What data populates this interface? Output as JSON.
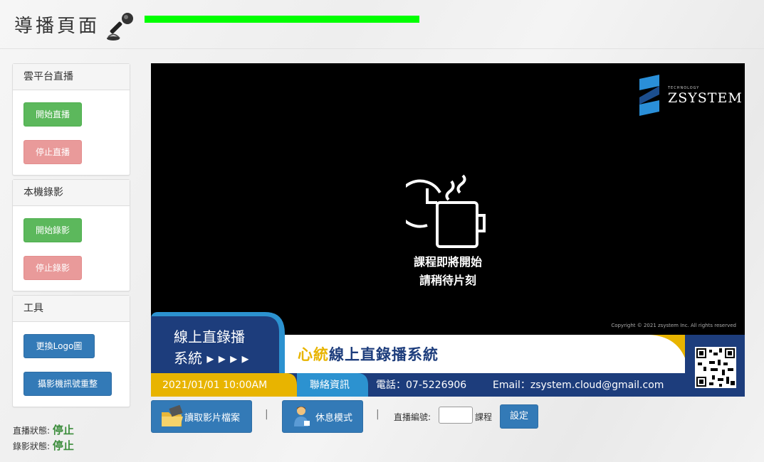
{
  "header": {
    "title": "導播頁面",
    "mic_icon": "microphone-icon",
    "audio_level": 1.0,
    "level_color": "#00ff00"
  },
  "sidebar": {
    "cloud_live": {
      "title": "雲平台直播",
      "start_label": "開始直播",
      "stop_label": "停止直播"
    },
    "local_record": {
      "title": "本機錄影",
      "start_label": "開始錄影",
      "stop_label": "停止錄影"
    },
    "tools": {
      "title": "工具",
      "logo_label": "更換Logo圖",
      "camera_label": "攝影機訊號重整"
    }
  },
  "status": {
    "live_label": "直播狀態:",
    "live_value": "停止",
    "record_label": "錄影狀態:",
    "record_value": "停止"
  },
  "preview": {
    "brand_tech": "TECHNOLOGY",
    "brand_name": "ZSYSTEM",
    "center_icon": "clock-coffee-icon",
    "message_line1": "課程即將開始",
    "message_line2": "請稍待片刻",
    "copyright": "Copyright © 2021 zsystem Inc. All rights reserved",
    "lower_third": {
      "tag_line1": "線上直錄播",
      "tag_line2": "系統 ▸ ▸ ▸ ▸",
      "title_highlight": "心統",
      "title_rest": "線上直錄播系統",
      "datetime": "2021/01/01   10:00AM",
      "contact_label": "聯絡資訊",
      "phone": "電話：07-5226906",
      "email": "Email：zsystem.cloud@gmail.com",
      "qr_icon": "qr-code-icon"
    }
  },
  "bottom_bar": {
    "load_video_label": "讀取影片檔案",
    "load_video_icon": "folder-film-icon",
    "break_mode_label": "休息模式",
    "break_mode_icon": "person-coffee-icon",
    "separator": "|",
    "live_number_label": "直播編號:",
    "live_number_value": "",
    "course_label": "課程",
    "set_label": "設定"
  },
  "colors": {
    "btn_green": "#5cb85c",
    "btn_red": "#e99a9a",
    "btn_blue": "#337ab7",
    "status_green": "#3c8d3c",
    "banner_navy": "#1d3d7c",
    "banner_gold": "#e8b400"
  }
}
